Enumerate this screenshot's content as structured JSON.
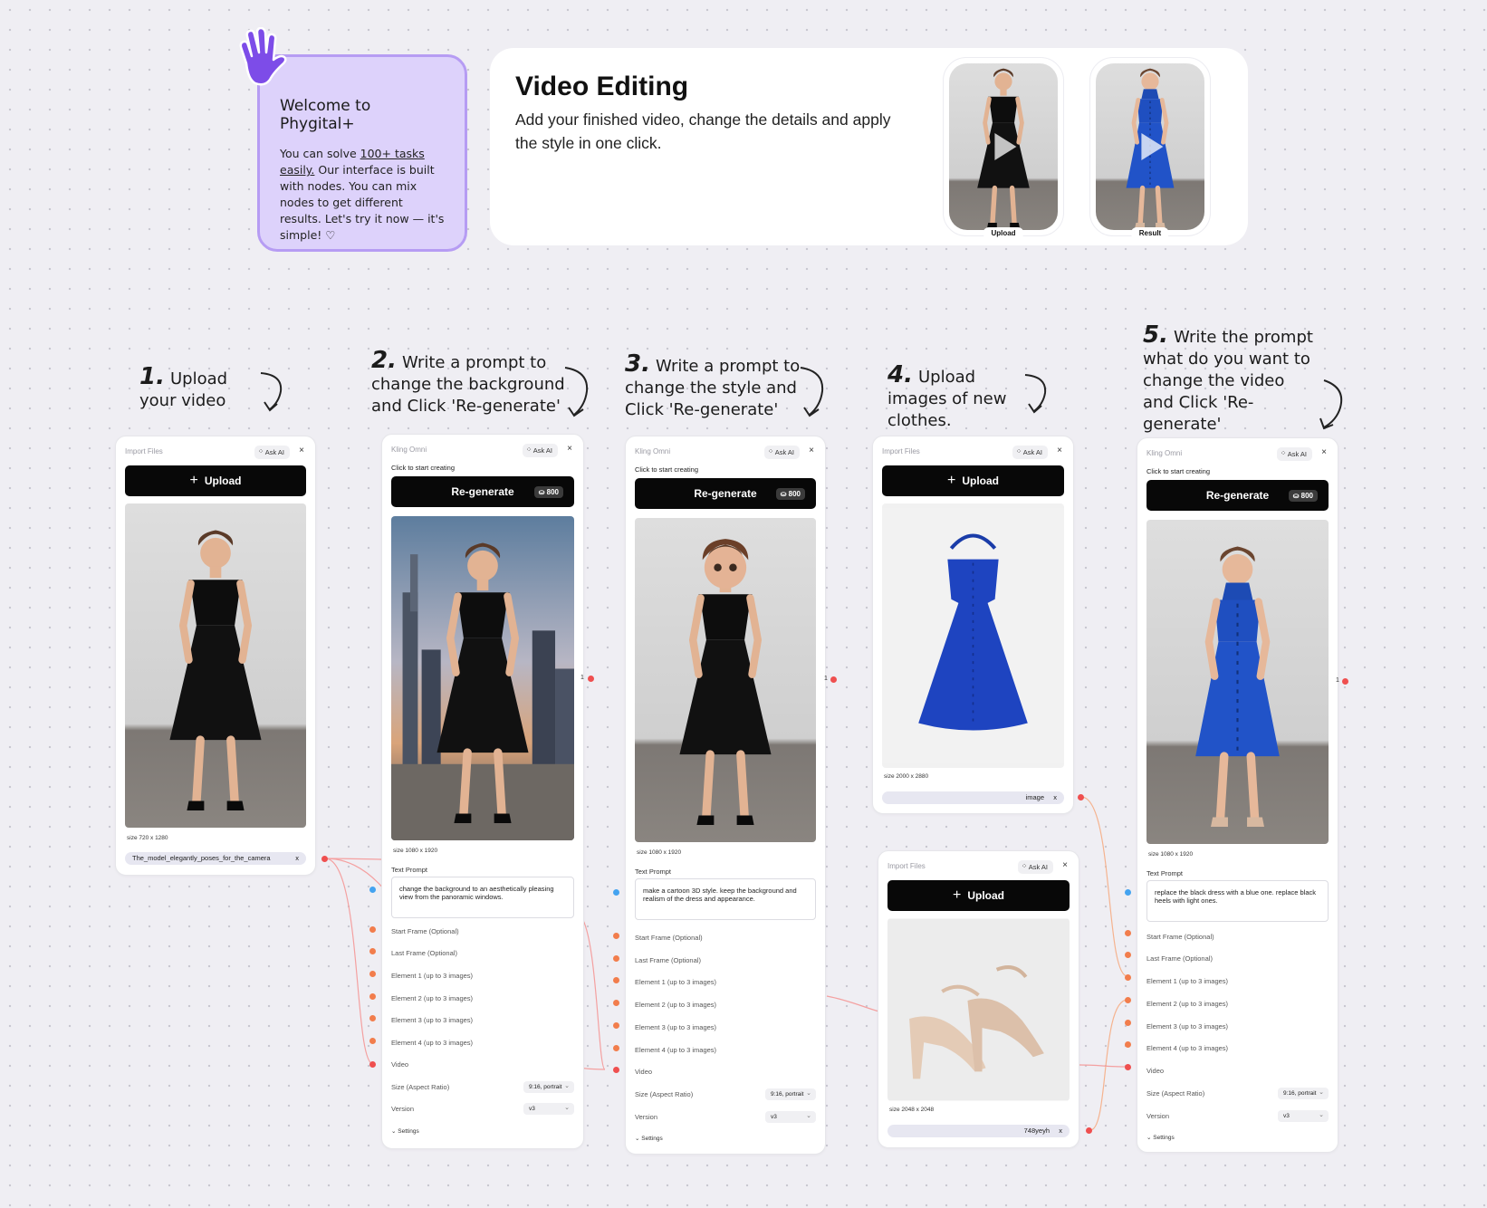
{
  "welcome": {
    "title": "Welcome to Phygital+",
    "text_before": "You can solve ",
    "text_link": "100+ tasks easily.",
    "text_after": " Our interface is built with nodes. You can mix nodes to get different results. Let's try it now — it's simple! ♡"
  },
  "hero": {
    "title": "Video Editing",
    "description": "Add your finished video, change the details and apply the style in one click.",
    "thumb_upload_label": "Upload",
    "thumb_result_label": "Result"
  },
  "steps": [
    {
      "num": "1.",
      "text": "Upload your video"
    },
    {
      "num": "2.",
      "text": "Write a prompt to change the background and Click 'Re-generate'"
    },
    {
      "num": "3.",
      "text": "Write a prompt to change the style and Click 'Re-generate'"
    },
    {
      "num": "4.",
      "text": "Upload images of new clothes."
    },
    {
      "num": "5.",
      "text": "Write the prompt what do you want to change the video and Click 'Re-generate'"
    }
  ],
  "common": {
    "import_files": "Import Files",
    "kling_omni": "Kling Omni",
    "ask_ai": "Ask AI",
    "close": "×",
    "upload": "Upload",
    "click_to_start": "Click to start creating",
    "regenerate": "Re-generate",
    "credits": "800",
    "text_prompt": "Text Prompt",
    "size_aspect": "Size (Aspect Ratio)",
    "version": "Version",
    "aspect_value": "9:16, portrait",
    "version_value": "v3",
    "settings": "Settings",
    "output_count": "1",
    "fields": [
      "Start Frame (Optional)",
      "Last Frame (Optional)",
      "Element 1 (up to 3 images)",
      "Element 2 (up to 3 images)",
      "Element 3 (up to 3 images)",
      "Element 4 (up to 3 images)",
      "Video"
    ]
  },
  "nodes": {
    "import_video": {
      "size": "size 720 x 1280",
      "file": "The_model_elegantly_poses_for_the_camera"
    },
    "kling1": {
      "size": "size 1080 x 1920",
      "prompt": "change the background to an aesthetically pleasing view from the panoramic windows."
    },
    "kling2": {
      "size": "size 1080 x 1920",
      "prompt": "make a cartoon 3D style. keep the background and realism of the dress and appearance."
    },
    "import_dress": {
      "size": "size 2000 x 2880",
      "file": "image"
    },
    "import_shoes": {
      "size": "size 2048 x 2048",
      "file": "748yeyh"
    },
    "kling3": {
      "size": "size 1080 x 1920",
      "prompt": "replace the black dress with a blue one. replace black heels with light ones."
    }
  },
  "colors": {
    "accent_purple": "#7d4ce8",
    "welcome_bg": "#ddd2fb",
    "wire_red": "#ef4f4f",
    "wire_orange": "#f27d4c",
    "port_blue": "#44a3f0",
    "button_black": "#080808"
  }
}
